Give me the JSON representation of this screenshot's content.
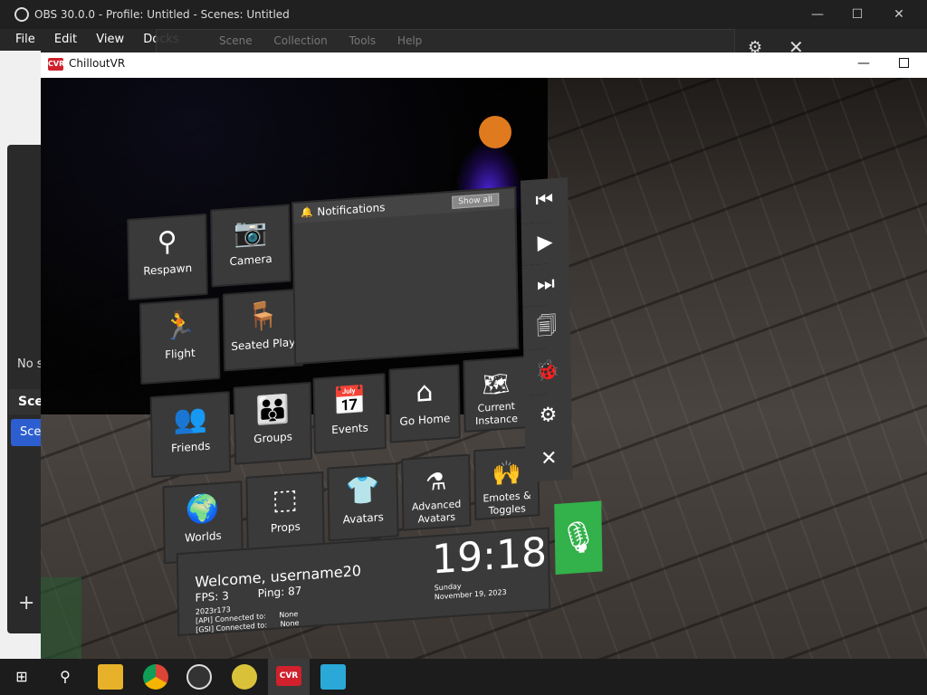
{
  "obs": {
    "title": "OBS 30.0.0 - Profile: Untitled - Scenes: Untitled",
    "menu": [
      "File",
      "Edit",
      "View",
      "Docks"
    ],
    "ghost_menu": "Scene Collection  Tools  Help",
    "no_source_text": "No s",
    "scenes_header": "Sce",
    "scene_item": "Scen",
    "add_label": "+"
  },
  "vr_window": {
    "title": "ChilloutVR",
    "logo": "CVR"
  },
  "menu": {
    "tiles": [
      {
        "label": "Respawn",
        "icon": "location-pin-icon",
        "glyph": "⚲"
      },
      {
        "label": "Camera",
        "icon": "camera-icon",
        "glyph": "📷"
      },
      {
        "label": "Flight",
        "icon": "flight-icon",
        "glyph": "🏃"
      },
      {
        "label": "Seated Play",
        "icon": "seated-icon",
        "glyph": "🪑"
      },
      {
        "label": "Friends",
        "icon": "friends-icon",
        "glyph": "👥"
      },
      {
        "label": "Groups",
        "icon": "groups-icon",
        "glyph": "👪"
      },
      {
        "label": "Events",
        "icon": "calendar-icon",
        "glyph": "📅"
      },
      {
        "label": "Go Home",
        "icon": "home-icon",
        "glyph": "⌂"
      },
      {
        "label": "Current Instance",
        "icon": "map-icon",
        "glyph": "🗺"
      },
      {
        "label": "Worlds",
        "icon": "globe-icon",
        "glyph": "🌍"
      },
      {
        "label": "Props",
        "icon": "cube-icon",
        "glyph": "⬚"
      },
      {
        "label": "Avatars",
        "icon": "avatar-icon",
        "glyph": "👕"
      },
      {
        "label": "Advanced Avatars",
        "icon": "potion-icon",
        "glyph": "⚗"
      },
      {
        "label": "Emotes & Toggles",
        "icon": "emotes-icon",
        "glyph": "🙌"
      }
    ],
    "notifications": {
      "title": "Notifications",
      "show_all": "Show all"
    },
    "side_buttons": [
      {
        "name": "previous-track-icon",
        "glyph": "⏮"
      },
      {
        "name": "play-icon",
        "glyph": "▶"
      },
      {
        "name": "next-track-icon",
        "glyph": "⏭"
      },
      {
        "name": "translate-icon",
        "glyph": "🗐"
      },
      {
        "name": "bug-icon",
        "glyph": "🐞"
      },
      {
        "name": "settings-icon",
        "glyph": "⚙"
      },
      {
        "name": "close-icon",
        "glyph": "✕"
      }
    ],
    "welcome": {
      "greeting": "Welcome, username20",
      "fps_label": "FPS:",
      "fps": "3",
      "ping_label": "Ping:",
      "ping": "87",
      "build": "2023r173",
      "api_label": "[API] Connected to:",
      "api": "None",
      "gsi_label": "[GSI] Connected to:",
      "gsi": "None",
      "time": "19:18",
      "weekday": "Sunday",
      "date": "November 19, 2023"
    }
  },
  "taskbar": [
    {
      "name": "windows-start-icon"
    },
    {
      "name": "search-icon"
    },
    {
      "name": "file-explorer-icon"
    },
    {
      "name": "chrome-icon"
    },
    {
      "name": "obs-icon"
    },
    {
      "name": "bee-app-icon"
    },
    {
      "name": "chilloutvr-taskbar-icon"
    },
    {
      "name": "app-window-icon"
    }
  ]
}
